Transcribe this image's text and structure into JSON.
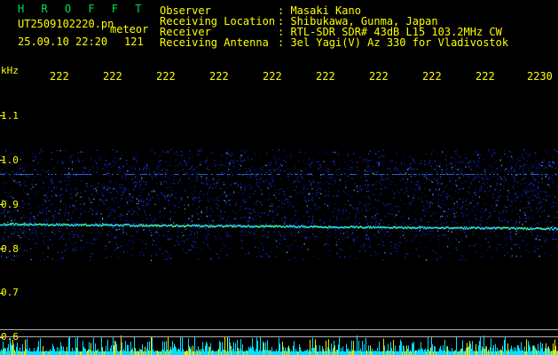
{
  "app_title": "H R O F F T",
  "file_name": "UT2509102220.pn",
  "mode_label": "meteor",
  "datetime": "25.09.10 22:20",
  "count": "121",
  "header": {
    "labels": [
      "Observer",
      "Receiving Location",
      "Receiver",
      "Receiving Antenna"
    ],
    "values": [
      ": Masaki Kano",
      ": Shibukawa, Gunma, Japan",
      ": RTL-SDR SDR# 43dB L15 103.2MHz CW",
      ": 3el Yagi(V) Az 330 for Vladivostok"
    ]
  },
  "time_ticks": [
    "222",
    "222",
    "222",
    "222",
    "222",
    "222",
    "222",
    "222",
    "222",
    "2230"
  ],
  "freq_unit": "kHz",
  "freq_ticks": [
    "1.1",
    "1.0",
    "0.9",
    "0.8",
    "0.7",
    "0.6"
  ],
  "colors": {
    "label_text": "#ffff00",
    "title_text": "#00e05a",
    "background": "#000000",
    "echo_line": "#40ff90",
    "noise": "#1a3cff",
    "baseline_bars": "#00e0ff",
    "separator": "#b0b0b0"
  }
}
